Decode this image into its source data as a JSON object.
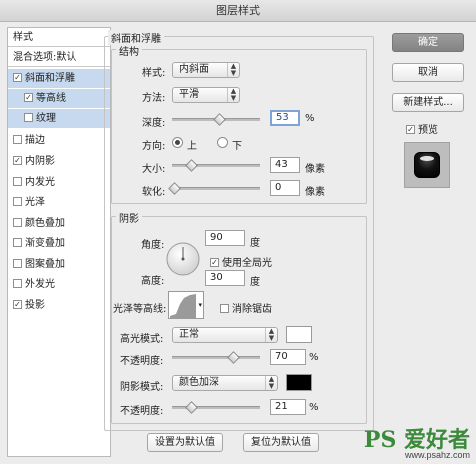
{
  "window": {
    "title": "图层样式"
  },
  "sidebar": {
    "header": "样式",
    "items": [
      {
        "label": "混合选项:默认",
        "check": null,
        "selected": false,
        "indent": false
      },
      {
        "label": "斜面和浮雕",
        "check": true,
        "selected": true,
        "indent": false
      },
      {
        "label": "等高线",
        "check": true,
        "selected": true,
        "indent": true
      },
      {
        "label": "纹理",
        "check": false,
        "selected": true,
        "indent": true
      },
      {
        "label": "描边",
        "check": false,
        "selected": false,
        "indent": false
      },
      {
        "label": "内阴影",
        "check": true,
        "selected": false,
        "indent": false
      },
      {
        "label": "内发光",
        "check": false,
        "selected": false,
        "indent": false
      },
      {
        "label": "光泽",
        "check": false,
        "selected": false,
        "indent": false
      },
      {
        "label": "颜色叠加",
        "check": false,
        "selected": false,
        "indent": false
      },
      {
        "label": "渐变叠加",
        "check": false,
        "selected": false,
        "indent": false
      },
      {
        "label": "图案叠加",
        "check": false,
        "selected": false,
        "indent": false
      },
      {
        "label": "外发光",
        "check": false,
        "selected": false,
        "indent": false
      },
      {
        "label": "投影",
        "check": true,
        "selected": false,
        "indent": false
      }
    ]
  },
  "bevel": {
    "section_title": "斜面和浮雕",
    "structure_title": "结构",
    "style_label": "样式:",
    "style_value": "内斜面",
    "technique_label": "方法:",
    "technique_value": "平滑",
    "depth_label": "深度:",
    "depth_value": "53",
    "depth_unit": "%",
    "direction_label": "方向:",
    "direction_up": "上",
    "direction_down": "下",
    "direction_selected": "上",
    "size_label": "大小:",
    "size_value": "43",
    "size_unit": "像素",
    "soften_label": "软化:",
    "soften_value": "0",
    "soften_unit": "像素"
  },
  "shading": {
    "section_title": "阴影",
    "angle_label": "角度:",
    "angle_value": "90",
    "angle_unit": "度",
    "global_light_label": "使用全局光",
    "global_light_checked": true,
    "altitude_label": "高度:",
    "altitude_value": "30",
    "altitude_unit": "度",
    "gloss_contour_label": "光泽等高线:",
    "anti_alias_label": "消除锯齿",
    "anti_alias_checked": false,
    "highlight_mode_label": "高光模式:",
    "highlight_mode_value": "正常",
    "highlight_color": "#ffffff",
    "highlight_opacity_label": "不透明度:",
    "highlight_opacity_value": "70",
    "highlight_opacity_unit": "%",
    "shadow_mode_label": "阴影模式:",
    "shadow_mode_value": "颜色加深",
    "shadow_color": "#000000",
    "shadow_opacity_label": "不透明度:",
    "shadow_opacity_value": "21",
    "shadow_opacity_unit": "%"
  },
  "footer": {
    "make_default": "设置为默认值",
    "reset_default": "复位为默认值"
  },
  "actions": {
    "ok": "确定",
    "cancel": "取消",
    "new_style": "新建样式...",
    "preview_label": "预览",
    "preview_checked": true
  },
  "watermark": {
    "main": "PS 爱好者",
    "sub": "www.psahz.com"
  },
  "colors": {
    "accent_focus": "#7ea4d6",
    "list_selected": "#c6d9ef",
    "ok_button": "#8f8f8f",
    "watermark": "#3c8a3a"
  }
}
